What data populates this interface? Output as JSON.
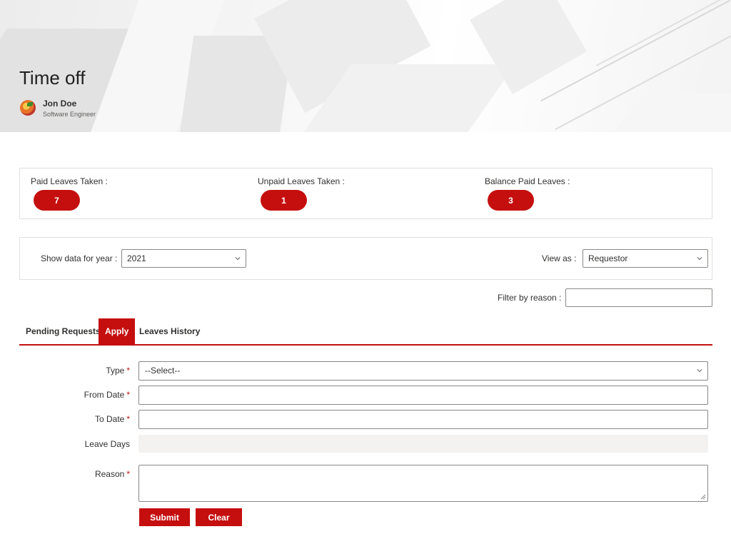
{
  "header": {
    "title": "Time off",
    "user": {
      "name": "Jon Doe",
      "role": "Software Engineer"
    }
  },
  "stats": [
    {
      "label": "Paid Leaves Taken :",
      "value": "7"
    },
    {
      "label": "Unpaid Leaves Taken :",
      "value": "1"
    },
    {
      "label": "Balance Paid Leaves :",
      "value": "3"
    }
  ],
  "filters": {
    "year_label": "Show data for year :",
    "year_value": "2021",
    "view_label": "View as :",
    "view_value": "Requestor",
    "reason_label": "Filter by reason :",
    "reason_value": ""
  },
  "tabs": [
    {
      "label": "Pending Requests",
      "active": false
    },
    {
      "label": "Apply",
      "active": true
    },
    {
      "label": "Leaves History",
      "active": false
    }
  ],
  "form": {
    "type_label": "Type",
    "type_value": "--Select--",
    "from_label": "From Date",
    "to_label": "To Date",
    "days_label": "Leave Days",
    "reason_label": "Reason",
    "required_mark": "*",
    "submit_label": "Submit",
    "clear_label": "Clear"
  },
  "colors": {
    "accent": "#c50f0f",
    "border": "#8a8886",
    "disabled": "#f3f2f1"
  }
}
